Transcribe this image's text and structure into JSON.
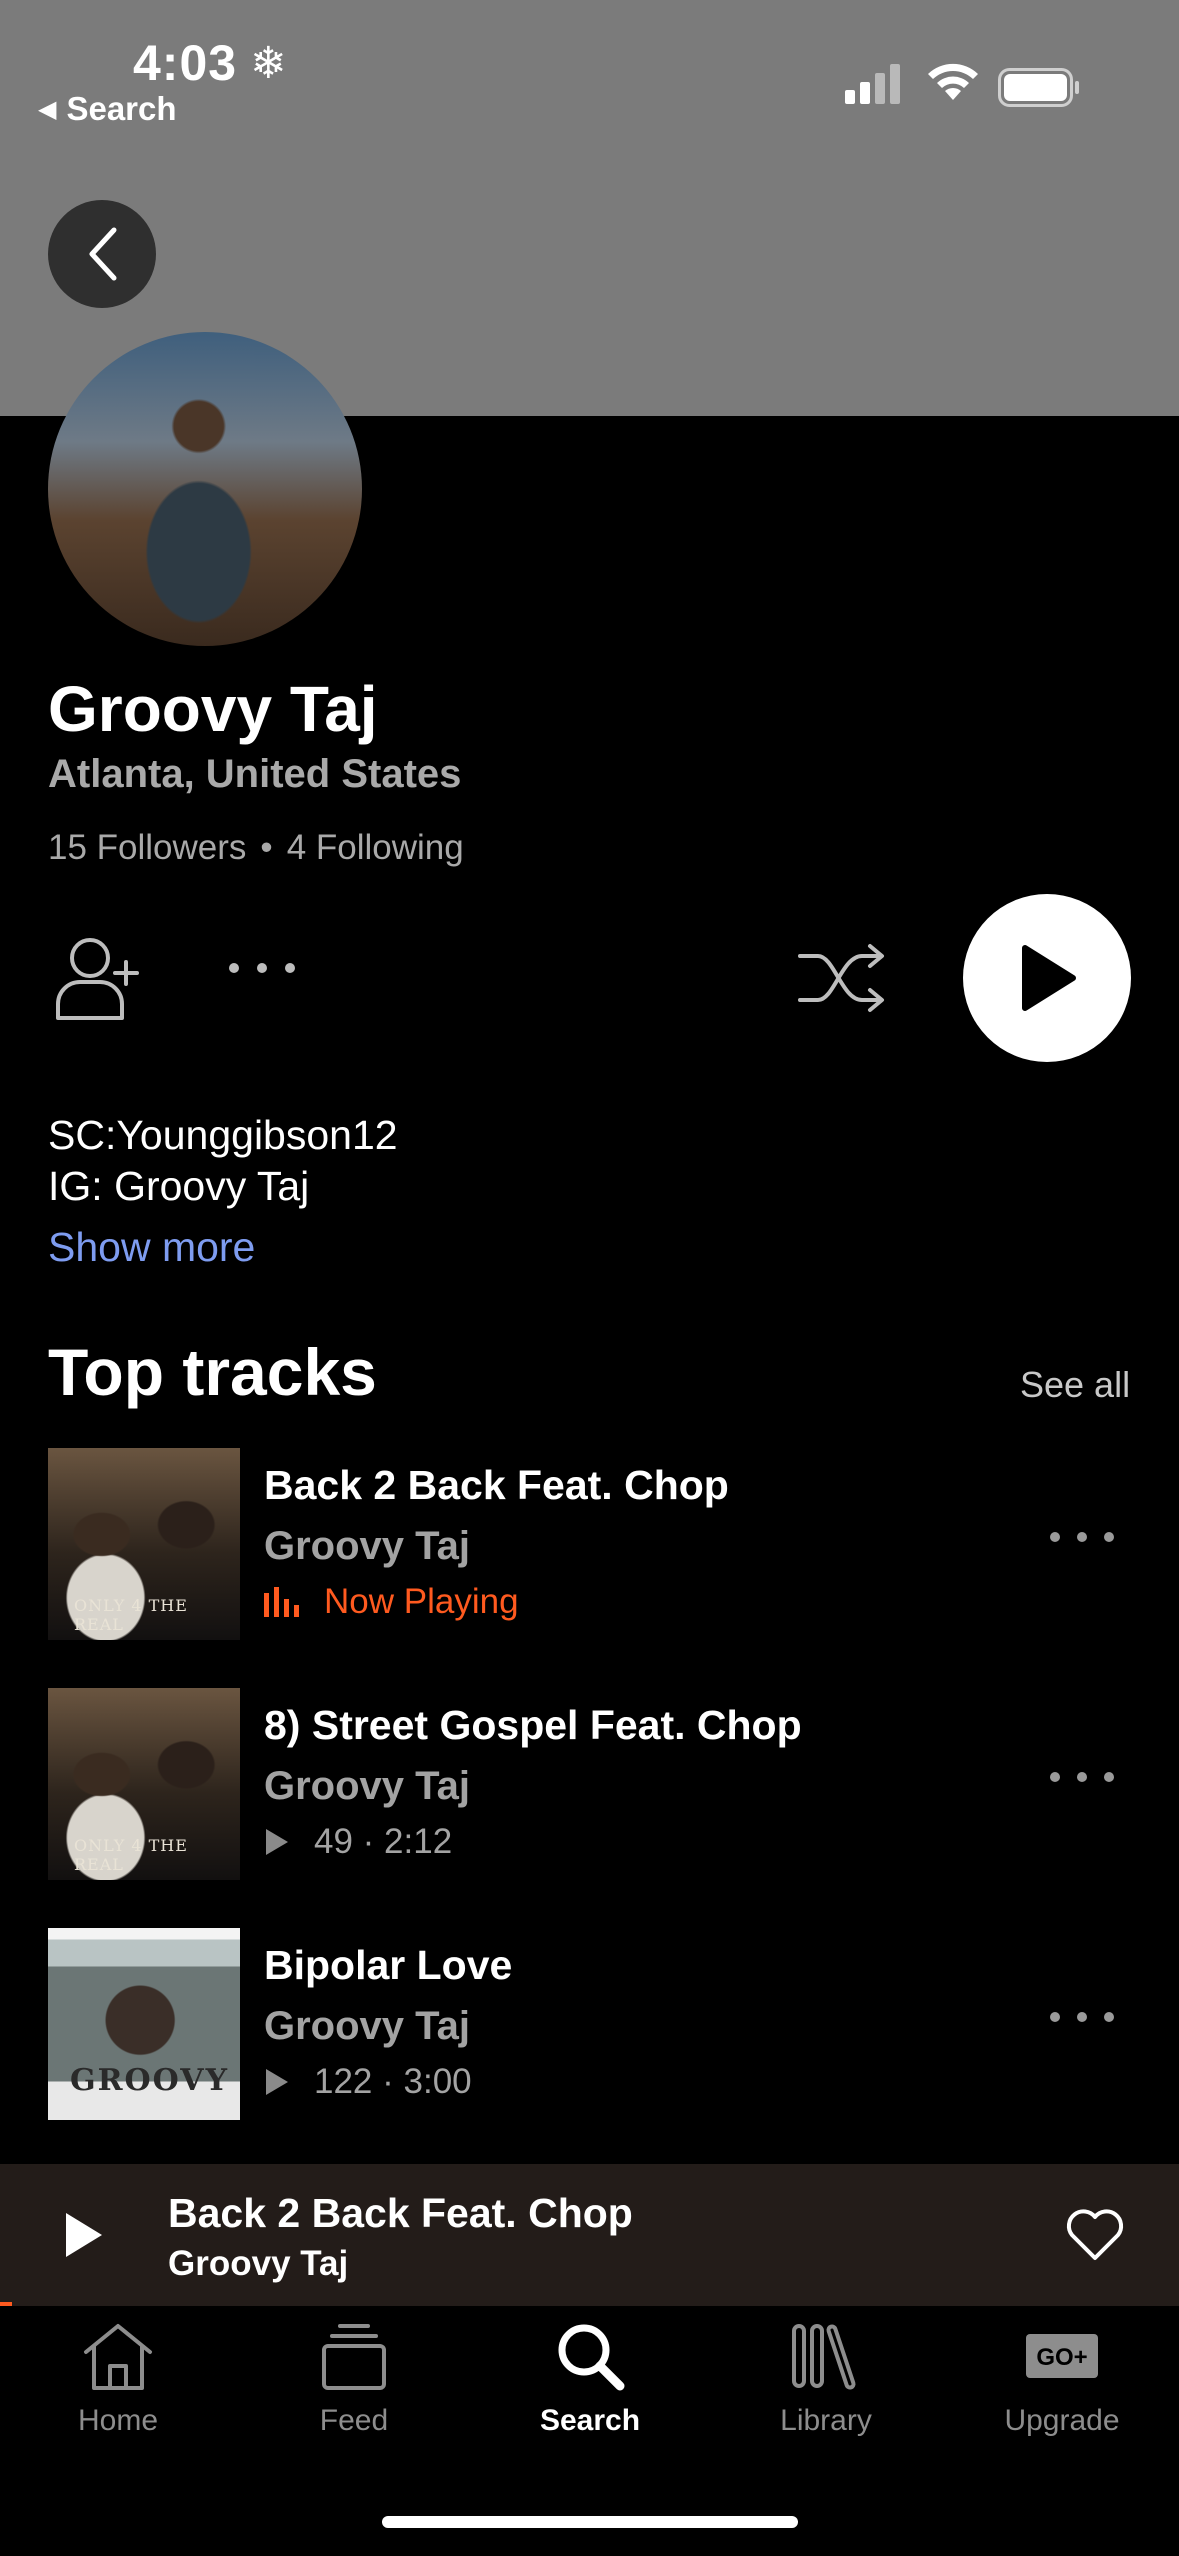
{
  "status_bar": {
    "time": "4:03",
    "back_app_label": "Search"
  },
  "artist": {
    "name": "Groovy Taj",
    "location": "Atlanta, United States",
    "followers": "15 Followers",
    "separator": "•",
    "following": "4 Following"
  },
  "bio": {
    "line1": "SC:Younggibson12",
    "line2": "IG: Groovy Taj",
    "show_more": "Show more"
  },
  "top_tracks": {
    "title": "Top tracks",
    "see_all": "See all",
    "items": [
      {
        "title": "Back 2 Back Feat. Chop",
        "artist": "Groovy Taj",
        "status": "Now Playing",
        "art_text": "ONLY 4 THE REAL"
      },
      {
        "title": "8) Street Gospel Feat. Chop",
        "artist": "Groovy Taj",
        "meta": "49 · 2:12",
        "art_text": "ONLY 4 THE REAL"
      },
      {
        "title": "Bipolar Love",
        "artist": "Groovy Taj",
        "meta": "122 · 3:00",
        "art_text": "GROOVY"
      }
    ]
  },
  "mini_player": {
    "title": "Back 2 Back Feat. Chop",
    "artist": "Groovy Taj",
    "progress_fraction": 0.01
  },
  "tabs": [
    {
      "label": "Home",
      "icon": "home-icon",
      "active": false
    },
    {
      "label": "Feed",
      "icon": "feed-icon",
      "active": false
    },
    {
      "label": "Search",
      "icon": "search-icon",
      "active": true
    },
    {
      "label": "Library",
      "icon": "library-icon",
      "active": false
    },
    {
      "label": "Upgrade",
      "icon": "go-plus-icon",
      "active": false,
      "badge": "GO+"
    }
  ],
  "colors": {
    "accent": "#ff5a1f",
    "link": "#7e9cf0",
    "header_bg": "#7b7b7b",
    "background": "#000000"
  }
}
